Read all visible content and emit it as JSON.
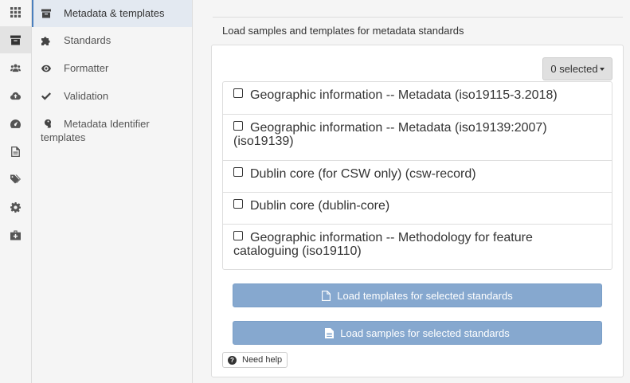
{
  "iconbar": {
    "items": [
      {
        "icon": "grid-icon"
      },
      {
        "icon": "archive-icon",
        "active": true
      },
      {
        "icon": "users-icon"
      },
      {
        "icon": "cloud-upload-icon"
      },
      {
        "icon": "dashboard-icon"
      },
      {
        "icon": "document-icon"
      },
      {
        "icon": "tags-icon"
      },
      {
        "icon": "gear-icon"
      },
      {
        "icon": "medkit-icon"
      }
    ]
  },
  "submenu": {
    "items": [
      {
        "label": "Metadata & templates",
        "icon": "archive-icon",
        "active": true
      },
      {
        "label": "Standards",
        "icon": "puzzle-icon"
      },
      {
        "label": "Formatter",
        "icon": "eye-icon"
      },
      {
        "label": "Validation",
        "icon": "check-icon"
      },
      {
        "label": "Metadata Identifier",
        "label2": "templates",
        "icon": "key-icon"
      }
    ]
  },
  "panel": {
    "heading": "Load samples and templates for metadata standards",
    "selected_label": "0 selected",
    "standards": [
      {
        "line1": "Geographic information -- Metadata (iso19115-3.2018)",
        "line2": ""
      },
      {
        "line1": "Geographic information -- Metadata (iso19139:2007)",
        "line2": "(iso19139)"
      },
      {
        "line1": "Dublin core (for CSW only) (csw-record)",
        "line2": ""
      },
      {
        "line1": "Dublin core (dublin-core)",
        "line2": ""
      },
      {
        "line1": "Geographic information -- Methodology for feature",
        "line2": "cataloguing (iso19110)"
      }
    ],
    "load_templates_label": "Load templates for selected standards",
    "load_samples_label": "Load samples for selected standards",
    "help_label": "Need help"
  },
  "colors": {
    "button_blue": "#86a8cf",
    "active_item_bg": "#e3e9f1"
  }
}
